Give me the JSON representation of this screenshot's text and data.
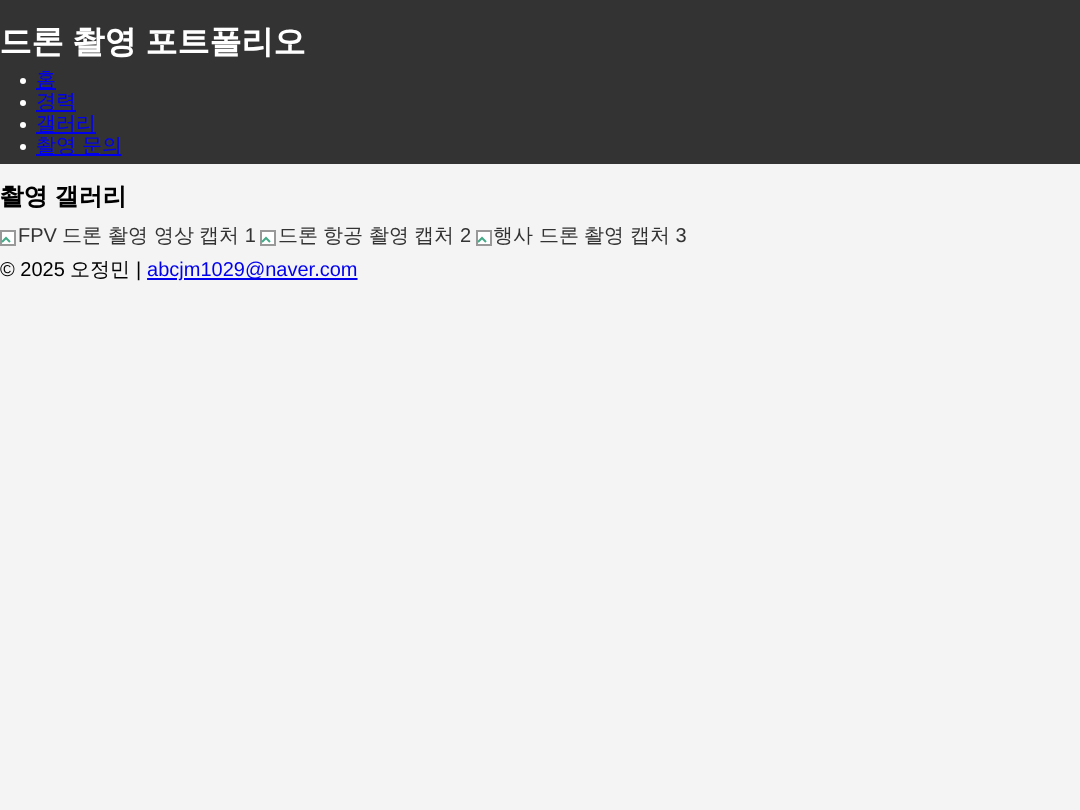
{
  "header": {
    "title": "드론 촬영 포트폴리오",
    "nav": [
      {
        "label": "홈"
      },
      {
        "label": "경력"
      },
      {
        "label": "갤러리"
      },
      {
        "label": "촬영 문의"
      }
    ]
  },
  "gallery": {
    "heading": "촬영 갤러리",
    "images": [
      {
        "alt": "FPV 드론 촬영 영상 캡처 1"
      },
      {
        "alt": "드론 항공 촬영 캡처 2"
      },
      {
        "alt": "행사 드론 촬영 캡처 3"
      }
    ]
  },
  "footer": {
    "text": "© 2025 오정민 |",
    "email": "abcjm1029@naver.com"
  }
}
